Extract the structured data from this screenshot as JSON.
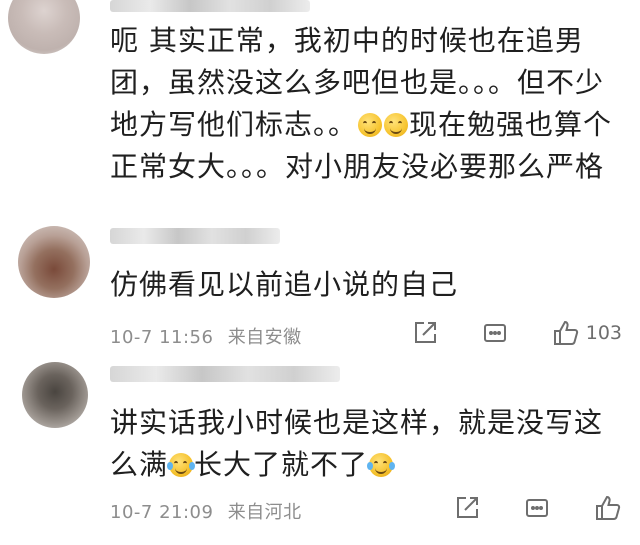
{
  "comments": [
    {
      "text_before_emoji": "呃 其实正常，我初中的时候也在追男团，虽然没这么多吧但也是。。。但不少地方写他们标志。。",
      "emojis": [
        "smile-emoji",
        "smile-emoji"
      ],
      "text_after_emoji": "现在勉强也算个正常女大。。。对小朋友没必要那么严格"
    },
    {
      "text": "仿佛看见以前追小说的自己",
      "date": "10-7 11:56",
      "location": "来自安徽",
      "likes": "103"
    },
    {
      "text_before_emoji": "讲实话我小时候也是这样，就是没写这么满",
      "emoji_1": "laugh-cry-emoji",
      "text_middle": "长大了就不了",
      "emoji_2": "laugh-cry-emoji",
      "date": "10-7 21:09",
      "location": "来自河北"
    }
  ],
  "colors": {
    "text": "#1f1f1f",
    "meta": "#8d8d8d",
    "icon": "#6e6e6e",
    "background": "#ffffff"
  }
}
